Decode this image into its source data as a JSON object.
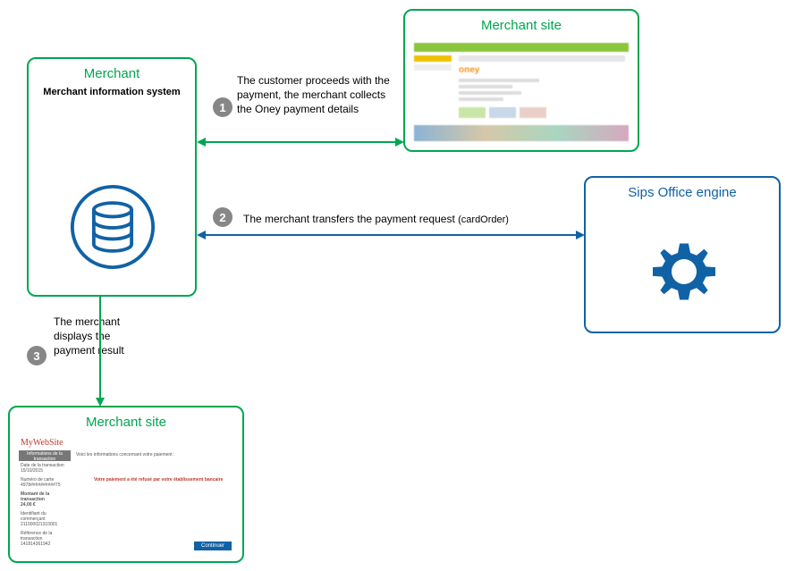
{
  "boxes": {
    "merchant": {
      "title": "Merchant",
      "subtitle": "Merchant information system"
    },
    "merchant_site_top": {
      "title": "Merchant site"
    },
    "merchant_site_bottom": {
      "title": "Merchant site"
    },
    "sips": {
      "title": "Sips Office engine"
    },
    "bottom_preview": {
      "brand": "MyWebSite",
      "header": "Informations de la transaction",
      "line_top": "Voici les informations concernant votre paiement :",
      "line_red": "Votre paiement a été refusé par votre établissement bancaire",
      "f1a": "Date de la transaction",
      "f1b": "15/10/2015",
      "f2a": "Numéro de carte",
      "f2b": "4978##########75",
      "f3a": "Montant de la transaction",
      "f3b": "24,00 €",
      "f4a": "Identifiant du commerçant",
      "f4b": "211000021310001",
      "f5a": "Référence de la transaction",
      "f5b": "141814361942",
      "btn": "Continuer"
    },
    "top_preview": {
      "brand": "oney"
    }
  },
  "steps": {
    "s1": {
      "num": "1",
      "text": "The customer proceeds with the payment, the merchant collects the Oney payment details"
    },
    "s2": {
      "num": "2",
      "text_a": "The merchant transfers the payment request ",
      "text_b": "(cardOrder)"
    },
    "s3": {
      "num": "3",
      "text": "The merchant displays the payment result"
    }
  },
  "colors": {
    "green": "#00a651",
    "blue": "#1062a5",
    "grey": "#878787"
  }
}
